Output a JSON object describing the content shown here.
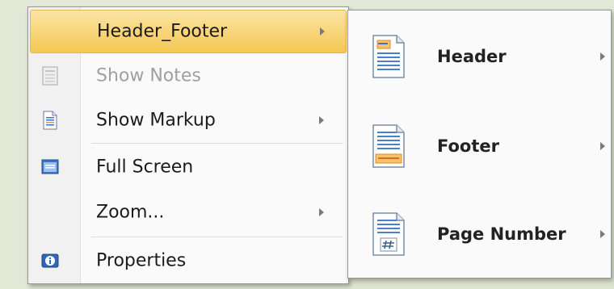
{
  "menu": {
    "items": [
      {
        "label": "Header_Footer",
        "has_submenu": true,
        "enabled": true,
        "highlighted": true,
        "icon": "none"
      },
      {
        "label": "Show Notes",
        "has_submenu": false,
        "enabled": false,
        "icon": "notes-icon"
      },
      {
        "label": "Show Markup",
        "has_submenu": true,
        "enabled": true,
        "icon": "document-markup-icon"
      },
      {
        "label": "Full Screen",
        "has_submenu": false,
        "enabled": true,
        "icon": "full-screen-icon"
      },
      {
        "label": "Zoom...",
        "has_submenu": true,
        "enabled": true,
        "icon": "none"
      },
      {
        "label": "Properties",
        "has_submenu": false,
        "enabled": true,
        "icon": "info-icon"
      }
    ]
  },
  "submenu": {
    "items": [
      {
        "label": "Header",
        "has_submenu": true,
        "icon": "header-page-icon"
      },
      {
        "label": "Footer",
        "has_submenu": true,
        "icon": "footer-page-icon"
      },
      {
        "label": "Page Number",
        "has_submenu": true,
        "icon": "page-number-icon"
      }
    ]
  },
  "colors": {
    "highlight": "#f8d77f",
    "disabled_text": "#a0a0a0",
    "icon_blue": "#3f74c4",
    "icon_orange": "#f0943a"
  }
}
